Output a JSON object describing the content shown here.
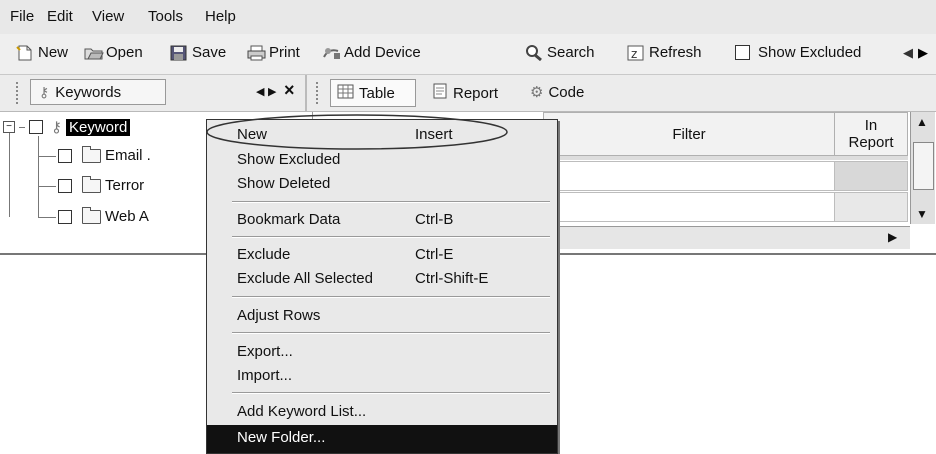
{
  "menubar": {
    "items": [
      "File",
      "Edit",
      "View",
      "Tools",
      "Help"
    ]
  },
  "toolbar": {
    "new_label": "New",
    "open_label": "Open",
    "save_label": "Save",
    "print_label": "Print",
    "add_device_label": "Add Device",
    "search_label": "Search",
    "refresh_label": "Refresh",
    "show_excluded_label": "Show Excluded"
  },
  "left_pane": {
    "tab_label": "Keywords",
    "tree": {
      "root_label": "Keyword",
      "children": [
        "Email .",
        "Terror",
        "Web A"
      ]
    }
  },
  "right_pane": {
    "tabs": [
      "Table",
      "Report",
      "Code"
    ],
    "columns": [
      "Filter",
      "In Report"
    ],
    "in_report_line1": "In",
    "in_report_line2": "Report"
  },
  "context_menu": {
    "items": [
      {
        "label": "New",
        "shortcut": "Insert"
      },
      {
        "label": "Show Excluded",
        "shortcut": ""
      },
      {
        "label": "Show Deleted",
        "shortcut": ""
      },
      {
        "label": "Bookmark Data",
        "shortcut": "Ctrl-B"
      },
      {
        "label": "Exclude",
        "shortcut": "Ctrl-E"
      },
      {
        "label": "Exclude All Selected",
        "shortcut": "Ctrl-Shift-E"
      },
      {
        "label": "Adjust Rows",
        "shortcut": ""
      },
      {
        "label": "Export...",
        "shortcut": ""
      },
      {
        "label": "Import...",
        "shortcut": ""
      },
      {
        "label": "Add Keyword List...",
        "shortcut": ""
      },
      {
        "label": "New Folder...",
        "shortcut": ""
      }
    ],
    "highlighted": "New Folder..."
  },
  "colors": {
    "menu_bg": "#e9e9e9",
    "highlight": "#111111",
    "toolbar_bg": "#efefef"
  }
}
